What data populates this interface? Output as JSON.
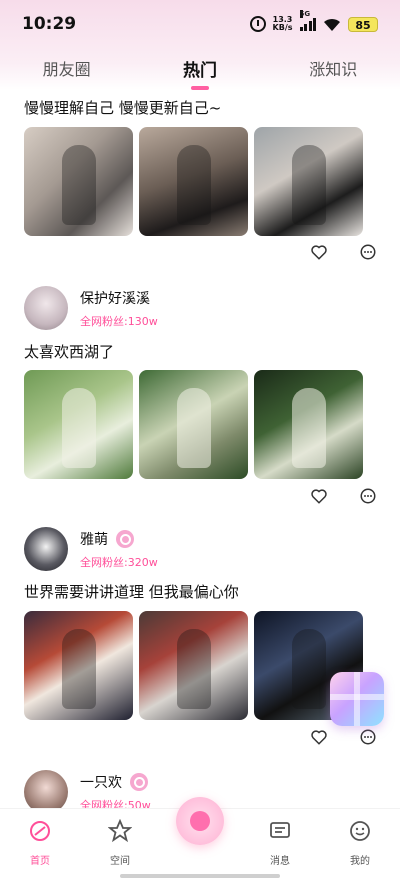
{
  "status_bar": {
    "time": "10:29",
    "net_speed_value": "13.3",
    "net_speed_unit": "KB/s",
    "signal_label": "5G",
    "battery": "85"
  },
  "tabs": [
    {
      "label": "朋友圈",
      "active": false
    },
    {
      "label": "热门",
      "active": true
    },
    {
      "label": "涨知识",
      "active": false
    }
  ],
  "posts": [
    {
      "text": "慢慢理解自己 慢慢更新自己~"
    },
    {
      "user": {
        "name": "保护好溪溪",
        "fans": "全网粉丝:130w",
        "verified": false
      },
      "text": "太喜欢西湖了"
    },
    {
      "user": {
        "name": "雅萌",
        "fans": "全网粉丝:320w",
        "verified": true
      },
      "text": "世界需要讲讲道理 但我最偏心你"
    },
    {
      "user": {
        "name": "一只欢",
        "fans": "全网粉丝:50w",
        "verified": true
      }
    }
  ],
  "bottom_nav": [
    {
      "label": "首页",
      "icon": "home-icon",
      "active": true
    },
    {
      "label": "空间",
      "icon": "space-icon",
      "active": false
    },
    {
      "label": "",
      "icon": "center-create-icon",
      "active": false
    },
    {
      "label": "消息",
      "icon": "message-icon",
      "active": false
    },
    {
      "label": "我的",
      "icon": "profile-icon",
      "active": false
    }
  ],
  "colors": {
    "accent": "#ff4f99",
    "header_bg": "#f7dcea"
  }
}
